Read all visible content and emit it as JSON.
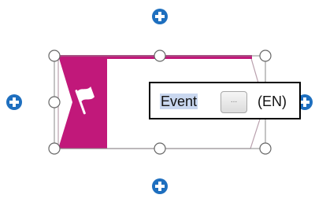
{
  "colors": {
    "accent": "#c1187a",
    "plus_handle": "#1e6fbf",
    "selection_border": "#000000",
    "text_highlight": "#c9d7ef"
  },
  "shape": {
    "type": "event",
    "icon": "flag-icon"
  },
  "editor": {
    "text": "Event",
    "button_label": "...",
    "language": "(EN)"
  },
  "icons": {
    "connector": "plus-icon",
    "resize": "resize-handle"
  }
}
